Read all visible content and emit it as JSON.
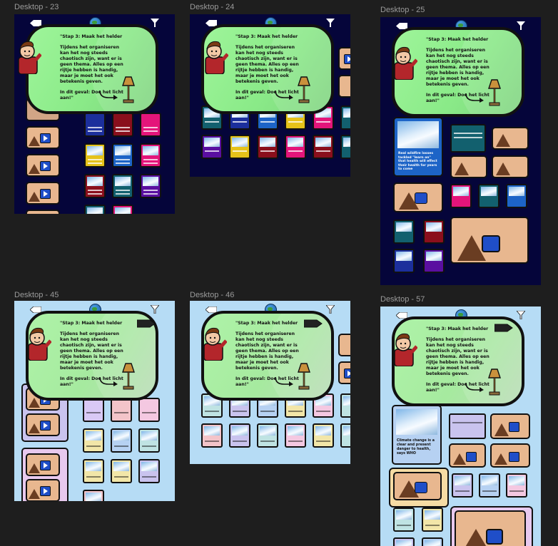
{
  "canvas": {
    "background": "#1e1e1e"
  },
  "colors": {
    "dark_frame": "#05053a",
    "light_frame": "#b6dcf5",
    "bubble_green": "#8aea88"
  },
  "bubble_text": {
    "heading": "\"Stap 3: Maak het helder",
    "body": "Tijdens het organiseren kan het nog steeds chaotisch zijn, want er is geen thema. Alles op een rijtje hebben is handig, maar je moet het ook betekenis geven.",
    "closing": "In dit geval: Doe het licht aan!\""
  },
  "frames": [
    {
      "label": "Desktop - 23"
    },
    {
      "label": "Desktop - 24"
    },
    {
      "label": "Desktop - 25"
    },
    {
      "label": "Desktop - 45"
    },
    {
      "label": "Desktop - 46"
    },
    {
      "label": "Desktop - 57"
    }
  ],
  "icons": {
    "back": "back-arrow-icon",
    "globe": "globe-icon",
    "filter": "funnel-icon",
    "lamp": "lamp-icon",
    "play": "play-icon"
  },
  "card_texts": {
    "wildfire": "Real wildfire losses tackled \"learn on\" that health will effect their health for years to come",
    "climate": "Climate change is a clear and present danger to health, says WHO"
  }
}
